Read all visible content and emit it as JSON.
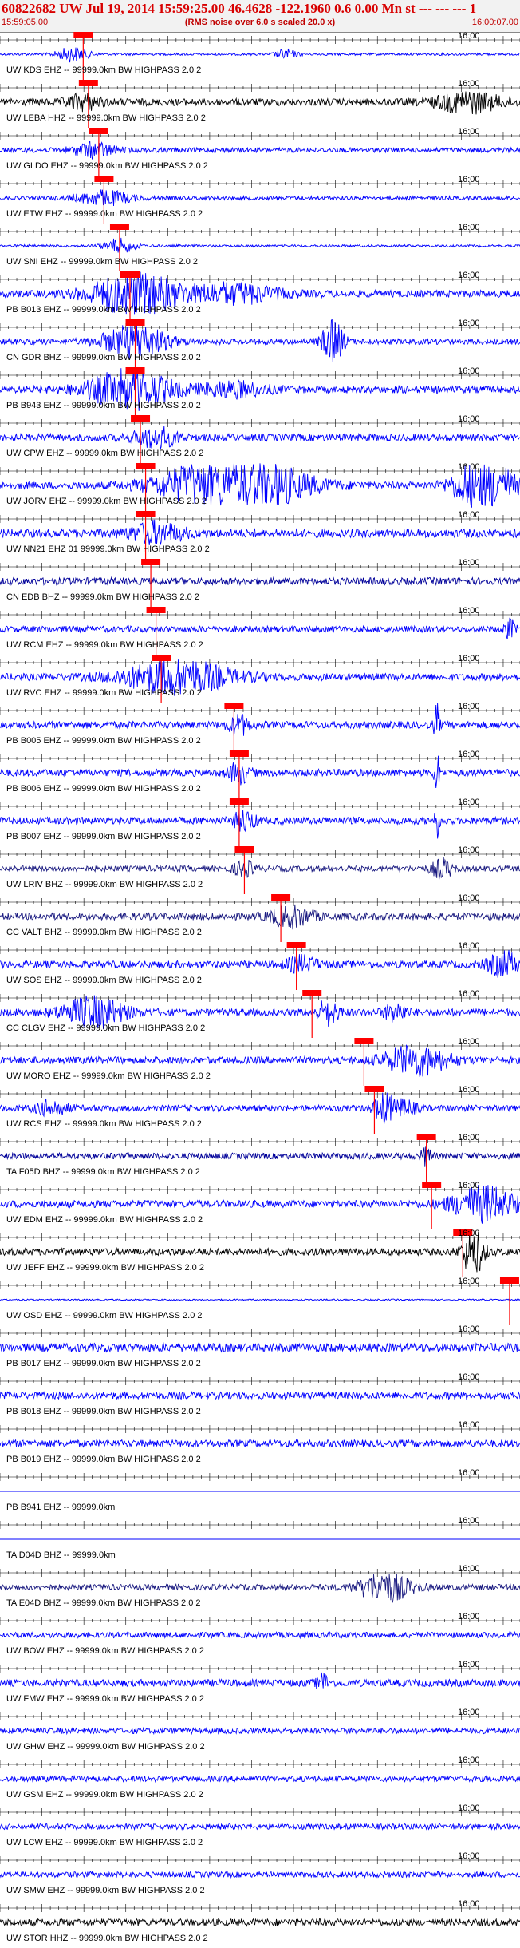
{
  "header": {
    "title": "60822682 UW Jul 19, 2014 15:59:25.00   46.4628 -122.1960   0.6 0.00 Mn st --- --- --- 1",
    "start_time": "15:59:05.00",
    "rms_note": "(RMS noise over 6.0 s scaled 20.0 x)",
    "end_time": "16:00:07.00"
  },
  "chart_data": {
    "type": "line",
    "title": "60822682 UW Jul 19, 2014 15:59:25.00   46.4628 -122.1960   0.6 0.00 Mn st --- --- --- 1",
    "x_range": [
      "15:59:05.00",
      "16:00:07.00"
    ],
    "tick_label": "16:00",
    "series": [
      {
        "name": "UW KDS EHZ -- 99999.0km BW  HIGHPASS  2.0  2",
        "pick": 0.16,
        "color": "#0000ff",
        "amp": 0.5,
        "bursts": [
          [
            0.14,
            0.03,
            3.0
          ],
          [
            0.55,
            0.02,
            2.0
          ]
        ]
      },
      {
        "name": "UW LEBA HHZ -- 99999.0km BW  HIGHPASS  2.0  2",
        "pick": 0.17,
        "color": "#000000",
        "amp": 1.5,
        "bursts": [
          [
            0.16,
            0.03,
            3.0
          ],
          [
            0.9,
            0.06,
            4.0
          ]
        ]
      },
      {
        "name": "UW GLDO EHZ -- 99999.0km BW  HIGHPASS  2.0  2",
        "pick": 0.19,
        "color": "#0000ff",
        "amp": 1.0,
        "bursts": [
          [
            0.18,
            0.04,
            3.0
          ]
        ]
      },
      {
        "name": "UW ETW EHZ -- 99999.0km BW  HIGHPASS  2.0  2",
        "pick": 0.2,
        "color": "#0000ff",
        "amp": 0.8,
        "bursts": [
          [
            0.2,
            0.05,
            3.0
          ]
        ]
      },
      {
        "name": "UW SNI EHZ -- 99999.0km BW  HIGHPASS  2.0  2",
        "pick": 0.23,
        "color": "#0000ff",
        "amp": 0.5,
        "bursts": [
          [
            0.23,
            0.03,
            3.0
          ]
        ]
      },
      {
        "name": "PB B013 EHZ -- 99999.0km BW  HIGHPASS  2.0  2",
        "pick": 0.25,
        "color": "#0000ff",
        "amp": 1.5,
        "bursts": [
          [
            0.26,
            0.08,
            9.0
          ],
          [
            0.45,
            0.08,
            4.0
          ]
        ]
      },
      {
        "name": "CN GDR BHZ -- 99999.0km BW  HIGHPASS  2.0  2",
        "pick": 0.26,
        "color": "#0000ff",
        "amp": 1.2,
        "bursts": [
          [
            0.26,
            0.06,
            7.0
          ],
          [
            0.64,
            0.02,
            9.0
          ]
        ]
      },
      {
        "name": "PB B943 EHZ -- 99999.0km BW  HIGHPASS  2.0  2",
        "pick": 0.26,
        "color": "#0000ff",
        "amp": 1.5,
        "bursts": [
          [
            0.25,
            0.08,
            8.0
          ],
          [
            0.45,
            0.06,
            3.0
          ]
        ]
      },
      {
        "name": "UW CPW EHZ -- 99999.0km BW  HIGHPASS  2.0  2",
        "pick": 0.27,
        "color": "#0000ff",
        "amp": 1.5,
        "bursts": [
          [
            0.3,
            0.04,
            4.0
          ]
        ]
      },
      {
        "name": "UW JORV EHZ -- 99999.0km BW  HIGHPASS  2.0  2",
        "pick": 0.28,
        "color": "#0000ff",
        "amp": 1.5,
        "bursts": [
          [
            0.45,
            0.12,
            14.0
          ],
          [
            0.93,
            0.05,
            14.0
          ]
        ]
      },
      {
        "name": "UW NN21 EHZ 01 99999.0km BW  HIGHPASS  2.0  2",
        "pick": 0.28,
        "color": "#0000ff",
        "amp": 1.8,
        "bursts": [
          [
            0.3,
            0.05,
            4.0
          ]
        ]
      },
      {
        "name": "CN EDB BHZ -- 99999.0km BW  HIGHPASS  2.0  2",
        "pick": 0.29,
        "color": "#000099",
        "amp": 1.5,
        "bursts": []
      },
      {
        "name": "UW RCM EHZ -- 99999.0km BW  HIGHPASS  2.0  2",
        "pick": 0.3,
        "color": "#0000ff",
        "amp": 1.3,
        "bursts": [
          [
            0.98,
            0.01,
            4.0
          ]
        ]
      },
      {
        "name": "UW RVC EHZ -- 99999.0km BW  HIGHPASS  2.0  2",
        "pick": 0.31,
        "color": "#0000ff",
        "amp": 1.5,
        "bursts": [
          [
            0.34,
            0.1,
            7.0
          ]
        ]
      },
      {
        "name": "PB B005 EHZ -- 99999.0km BW  HIGHPASS  2.0  2",
        "pick": 0.45,
        "color": "#0000ff",
        "amp": 1.5,
        "bursts": [
          [
            0.46,
            0.02,
            4.0
          ],
          [
            0.84,
            0.005,
            9.0
          ]
        ]
      },
      {
        "name": "PB B006 EHZ -- 99999.0km BW  HIGHPASS  2.0  2",
        "pick": 0.46,
        "color": "#0000ff",
        "amp": 1.5,
        "bursts": [
          [
            0.46,
            0.02,
            4.0
          ],
          [
            0.84,
            0.005,
            9.0
          ]
        ]
      },
      {
        "name": "PB B007 EHZ -- 99999.0km BW  HIGHPASS  2.0  2",
        "pick": 0.46,
        "color": "#0000ff",
        "amp": 1.5,
        "bursts": [
          [
            0.47,
            0.02,
            4.0
          ],
          [
            0.84,
            0.005,
            7.0
          ]
        ]
      },
      {
        "name": "UW LRIV BHZ -- 99999.0km BW  HIGHPASS  2.0  2",
        "pick": 0.47,
        "color": "#1a1a80",
        "amp": 1.2,
        "bursts": [
          [
            0.47,
            0.02,
            3.0
          ],
          [
            0.85,
            0.02,
            4.0
          ]
        ]
      },
      {
        "name": "CC VALT BHZ -- 99999.0km BW  HIGHPASS  2.0  2",
        "pick": 0.54,
        "color": "#1a1a80",
        "amp": 1.5,
        "bursts": [
          [
            0.56,
            0.04,
            4.0
          ]
        ]
      },
      {
        "name": "UW SOS EHZ -- 99999.0km BW  HIGHPASS  2.0  2",
        "pick": 0.57,
        "color": "#0000ff",
        "amp": 1.5,
        "bursts": [
          [
            0.58,
            0.03,
            3.0
          ],
          [
            0.97,
            0.03,
            5.0
          ]
        ]
      },
      {
        "name": "CC CLGV EHZ -- 99999.0km BW  HIGHPASS  2.0  2",
        "pick": 0.6,
        "color": "#0000ff",
        "amp": 1.5,
        "bursts": [
          [
            0.18,
            0.06,
            6.0
          ],
          [
            0.63,
            0.02,
            5.0
          ],
          [
            0.76,
            0.02,
            4.0
          ]
        ]
      },
      {
        "name": "UW MORO EHZ -- 99999.0km BW  HIGHPASS  2.0  2",
        "pick": 0.7,
        "color": "#0000ff",
        "amp": 1.5,
        "bursts": [
          [
            0.8,
            0.06,
            6.0
          ]
        ]
      },
      {
        "name": "UW RCS EHZ -- 99999.0km BW  HIGHPASS  2.0  2",
        "pick": 0.72,
        "color": "#0000ff",
        "amp": 1.3,
        "bursts": [
          [
            0.1,
            0.03,
            3.0
          ],
          [
            0.74,
            0.02,
            6.0
          ],
          [
            0.78,
            0.02,
            3.0
          ]
        ]
      },
      {
        "name": "TA F05D BHZ -- 99999.0km BW  HIGHPASS  2.0  2",
        "pick": 0.82,
        "color": "#000099",
        "amp": 1.3,
        "bursts": [
          [
            0.82,
            0.01,
            4.0
          ]
        ]
      },
      {
        "name": "UW EDM EHZ -- 99999.0km BW  HIGHPASS  2.0  2",
        "pick": 0.83,
        "color": "#0000ff",
        "amp": 1.5,
        "bursts": [
          [
            0.93,
            0.06,
            7.0
          ]
        ]
      },
      {
        "name": "UW JEFF EHZ -- 99999.0km BW  HIGHPASS  2.0  2",
        "pick": 0.89,
        "color": "#000000",
        "amp": 1.5,
        "bursts": [
          [
            0.91,
            0.02,
            10.0
          ]
        ]
      },
      {
        "name": "UW OSD EHZ -- 99999.0km BW  HIGHPASS  2.0  2",
        "pick": 0.98,
        "color": "#0000ff",
        "amp": 0.3,
        "bursts": []
      },
      {
        "name": "PB B017 EHZ -- 99999.0km BW  HIGHPASS  2.0  2",
        "pick": null,
        "color": "#0000ff",
        "amp": 1.8,
        "bursts": []
      },
      {
        "name": "PB B018 EHZ -- 99999.0km BW  HIGHPASS  2.0  2",
        "pick": null,
        "color": "#0000ff",
        "amp": 1.5,
        "bursts": []
      },
      {
        "name": "PB B019 EHZ -- 99999.0km BW  HIGHPASS  2.0  2",
        "pick": null,
        "color": "#0000ff",
        "amp": 1.5,
        "bursts": []
      },
      {
        "name": "PB B941 EHZ -- 99999.0km",
        "pick": null,
        "color": "#0000ff",
        "amp": 0.0,
        "bursts": []
      },
      {
        "name": "TA D04D BHZ -- 99999.0km",
        "pick": null,
        "color": "#0000ff",
        "amp": 0.0,
        "bursts": []
      },
      {
        "name": "TA E04D BHZ -- 99999.0km BW  HIGHPASS  2.0  2",
        "pick": null,
        "color": "#1a1a80",
        "amp": 1.2,
        "bursts": [
          [
            0.74,
            0.05,
            6.0
          ]
        ]
      },
      {
        "name": "UW BOW EHZ -- 99999.0km BW  HIGHPASS  2.0  2",
        "pick": null,
        "color": "#0000ff",
        "amp": 1.2,
        "bursts": []
      },
      {
        "name": "UW FMW EHZ -- 99999.0km BW  HIGHPASS  2.0  2",
        "pick": null,
        "color": "#0000ff",
        "amp": 1.5,
        "bursts": [
          [
            0.62,
            0.01,
            4.0
          ]
        ]
      },
      {
        "name": "UW GHW EHZ -- 99999.0km BW  HIGHPASS  2.0  2",
        "pick": null,
        "color": "#0000ff",
        "amp": 1.2,
        "bursts": []
      },
      {
        "name": "UW GSM EHZ -- 99999.0km BW  HIGHPASS  2.0  2",
        "pick": null,
        "color": "#0000ff",
        "amp": 1.2,
        "bursts": []
      },
      {
        "name": "UW LCW EHZ -- 99999.0km BW  HIGHPASS  2.0  2",
        "pick": null,
        "color": "#0000ff",
        "amp": 1.2,
        "bursts": []
      },
      {
        "name": "UW SMW EHZ -- 99999.0km BW  HIGHPASS  2.0  2",
        "pick": null,
        "color": "#0000ff",
        "amp": 1.2,
        "bursts": []
      },
      {
        "name": "UW STOR HHZ -- 99999.0km BW  HIGHPASS  2.0  2",
        "pick": null,
        "color": "#000000",
        "amp": 1.5,
        "bursts": []
      }
    ]
  }
}
